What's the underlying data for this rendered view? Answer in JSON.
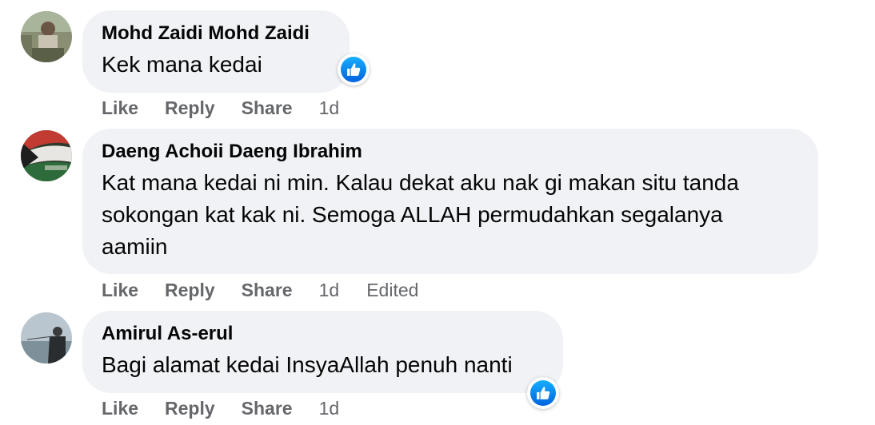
{
  "colors": {
    "bubble": "#f0f2f5",
    "meta": "#65676b",
    "text": "#050505",
    "like_blue": "#1877f2"
  },
  "comments": [
    {
      "author": "Mohd Zaidi Mohd Zaidi",
      "text": "Kek mana kedai",
      "actions": {
        "like": "Like",
        "reply": "Reply",
        "share": "Share"
      },
      "time": "1d",
      "reaction_icon": "thumbs-up-icon"
    },
    {
      "author": "Daeng Achoii Daeng Ibrahim",
      "text_lines": [
        "Kat mana kedai ni min. Kalau dekat aku nak gi makan situ tanda",
        "sokongan kat kak ni. Semoga ALLAH permudahkan segalanya",
        "aamiin"
      ],
      "actions": {
        "like": "Like",
        "reply": "Reply",
        "share": "Share"
      },
      "time": "1d",
      "edited": "Edited"
    },
    {
      "author": "Amirul As-erul",
      "text": "Bagi alamat kedai InsyaAllah penuh nanti",
      "actions": {
        "like": "Like",
        "reply": "Reply",
        "share": "Share"
      },
      "time": "1d",
      "reaction_icon": "thumbs-up-icon"
    }
  ]
}
